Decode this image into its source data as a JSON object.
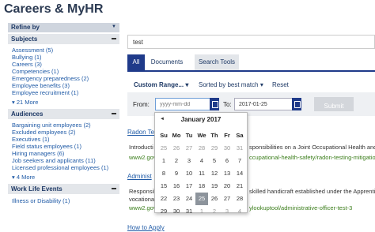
{
  "page": {
    "title": "Careers & MyHR"
  },
  "sidebar": {
    "refine_label": "Refine by",
    "refine_caret": "▼",
    "subjects": {
      "title": "Subjects",
      "items": [
        "Assessment (5)",
        "Bullying (1)",
        "Careers (3)",
        "Competencies (1)",
        "Emergency preparedness (2)",
        "Employee benefits (3)",
        "Employee recruitment (1)"
      ],
      "more": "▾ 21 More"
    },
    "audiences": {
      "title": "Audiences",
      "items": [
        "Bargaining unit employees (2)",
        "Excluded employees (2)",
        "Executives (1)",
        "Field status employees (1)",
        "Hiring managers (6)",
        "Job seekers and applicants (11)",
        "Licensed professional employees (1)"
      ],
      "more": "▾ 4 More"
    },
    "work_life": {
      "title": "Work Life Events",
      "items": [
        "Illness or Disability (1)"
      ]
    }
  },
  "search": {
    "value": "test"
  },
  "tabs": {
    "all": "All",
    "documents": "Documents",
    "search_tools": "Search Tools"
  },
  "filters": {
    "range": "Custom Range... ▾",
    "sort": "Sorted by best match ▾",
    "reset": "Reset"
  },
  "date_range": {
    "from_label": "From:",
    "from_placeholder": "yyyy-mm-dd",
    "to_label": "To:",
    "to_value": "2017-01-25",
    "submit": "Submit"
  },
  "results": [
    {
      "title": "Radon Te",
      "text_left": "Introducti",
      "text_right": "sponsibilities on a Joint Occupational Health and",
      "url_left": "www2.gov",
      "url_right": "ccupational-health-safety/radon-testing-mitigation"
    },
    {
      "title": "Administ",
      "text_left": "Responsib",
      "text_right": "skilled handicraft established under the Apprentice",
      "text_line2": "vocational",
      "url_left": "www2.gov",
      "url_right": "ylookuptool/administrative-officer-test-3"
    },
    {
      "title": "How to Apply"
    }
  ],
  "calendar": {
    "prev": "◄",
    "month_label": "January 2017",
    "weekdays": [
      "Su",
      "Mo",
      "Tu",
      "We",
      "Th",
      "Fr",
      "Sa"
    ],
    "weeks": [
      [
        "25",
        "26",
        "27",
        "28",
        "29",
        "30",
        "31"
      ],
      [
        "1",
        "2",
        "3",
        "4",
        "5",
        "6",
        "7"
      ],
      [
        "8",
        "9",
        "10",
        "11",
        "12",
        "13",
        "14"
      ],
      [
        "15",
        "16",
        "17",
        "18",
        "19",
        "20",
        "21"
      ],
      [
        "22",
        "23",
        "24",
        "25",
        "26",
        "27",
        "28"
      ],
      [
        "29",
        "30",
        "31",
        "1",
        "2",
        "3",
        "4"
      ]
    ],
    "selected_day": "25"
  }
}
